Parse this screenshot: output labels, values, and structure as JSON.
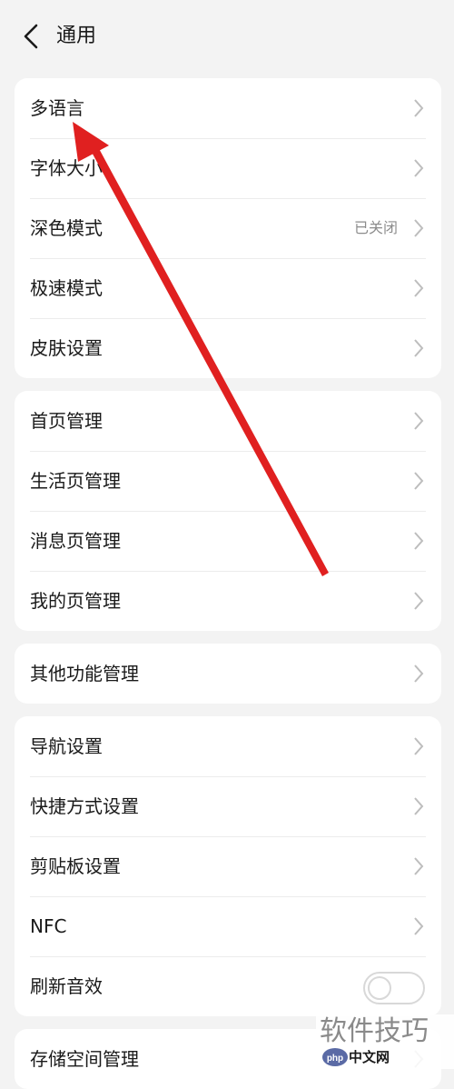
{
  "header": {
    "back_icon": "chevron-left-icon",
    "title": "通用"
  },
  "group1": [
    {
      "label": "多语言"
    },
    {
      "label": "字体大小"
    },
    {
      "label": "深色模式",
      "value": "已关闭"
    },
    {
      "label": "极速模式"
    },
    {
      "label": "皮肤设置"
    }
  ],
  "group2": [
    {
      "label": "首页管理"
    },
    {
      "label": "生活页管理"
    },
    {
      "label": "消息页管理"
    },
    {
      "label": "我的页管理"
    }
  ],
  "group3": [
    {
      "label": "其他功能管理"
    }
  ],
  "group4": [
    {
      "label": "导航设置"
    },
    {
      "label": "快捷方式设置"
    },
    {
      "label": "剪贴板设置"
    },
    {
      "label": "NFC"
    },
    {
      "label": "刷新音效",
      "toggle_on": false
    }
  ],
  "group5": [
    {
      "label": "存储空间管理"
    }
  ],
  "annotation": {
    "type": "arrow",
    "color": "#e02020",
    "points_to": "多语言"
  },
  "watermark": {
    "text_top": "软件技巧",
    "text_bottom": "中文网",
    "logo": "php"
  },
  "colors": {
    "background": "#f3f3f3",
    "card": "#ffffff",
    "text": "#1a1a1a",
    "secondary_text": "#8c8c8c",
    "chevron": "#bdbdbd"
  }
}
